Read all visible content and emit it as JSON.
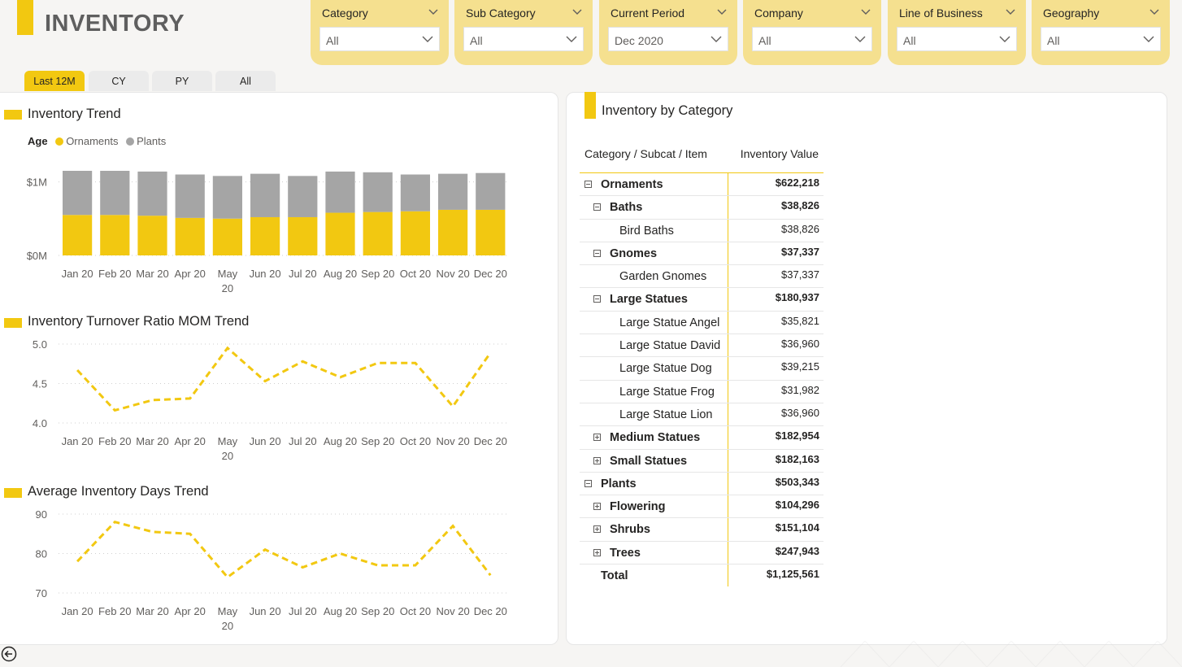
{
  "page": {
    "title": "INVENTORY"
  },
  "slicers": [
    {
      "label": "Category",
      "value": "All"
    },
    {
      "label": "Sub Category",
      "value": "All"
    },
    {
      "label": "Current Period",
      "value": "Dec 2020"
    },
    {
      "label": "Company",
      "value": "All"
    },
    {
      "label": "Line of Business",
      "value": "All"
    },
    {
      "label": "Geography",
      "value": "All"
    }
  ],
  "tabs": [
    {
      "label": "Last 12M",
      "active": true
    },
    {
      "label": "CY",
      "active": false
    },
    {
      "label": "PY",
      "active": false
    },
    {
      "label": "All",
      "active": false
    }
  ],
  "colors": {
    "accent": "#f2c811",
    "grey": "#a5a5a5",
    "slicer_bg": "#f5e08f"
  },
  "chart_data": [
    {
      "type": "bar",
      "title": "Inventory Trend",
      "legend_title": "Age",
      "categories": [
        "Jan 20",
        "Feb 20",
        "Mar 20",
        "Apr 20",
        "May 20",
        "Jun 20",
        "Jul 20",
        "Aug 20",
        "Sep 20",
        "Oct 20",
        "Nov 20",
        "Dec 20"
      ],
      "series": [
        {
          "name": "Ornaments",
          "color": "#f2c811",
          "values": [
            0.55,
            0.55,
            0.54,
            0.51,
            0.5,
            0.52,
            0.52,
            0.58,
            0.59,
            0.6,
            0.62,
            0.62
          ]
        },
        {
          "name": "Plants",
          "color": "#a5a5a5",
          "values": [
            0.6,
            0.6,
            0.6,
            0.59,
            0.58,
            0.59,
            0.56,
            0.56,
            0.54,
            0.5,
            0.49,
            0.5
          ]
        }
      ],
      "yticks": [
        "$1M",
        "$0M"
      ],
      "ylim": [
        0,
        1.15
      ],
      "stacked": true,
      "grid": true
    },
    {
      "type": "line",
      "title": "Inventory Turnover Ratio MOM Trend",
      "categories": [
        "Jan 20",
        "Feb 20",
        "Mar 20",
        "Apr 20",
        "May 20",
        "Jun 20",
        "Jul 20",
        "Aug 20",
        "Sep 20",
        "Oct 20",
        "Nov 20",
        "Dec 20"
      ],
      "series": [
        {
          "color": "#f2c811",
          "values": [
            4.67,
            4.16,
            4.29,
            4.31,
            4.95,
            4.53,
            4.78,
            4.58,
            4.76,
            4.76,
            4.21,
            4.89
          ]
        }
      ],
      "yticks": [
        "5.0",
        "4.5",
        "4.0"
      ],
      "ylim": [
        4.0,
        5.0
      ],
      "grid": true
    },
    {
      "type": "line",
      "title": "Average Inventory Days Trend",
      "categories": [
        "Jan 20",
        "Feb 20",
        "Mar 20",
        "Apr 20",
        "May 20",
        "Jun 20",
        "Jul 20",
        "Aug 20",
        "Sep 20",
        "Oct 20",
        "Nov 20",
        "Dec 20"
      ],
      "series": [
        {
          "color": "#f2c811",
          "values": [
            78,
            88,
            85.5,
            85,
            74,
            81,
            76.5,
            80,
            77,
            77,
            87,
            74.5
          ]
        }
      ],
      "yticks": [
        "90",
        "80",
        "70"
      ],
      "ylim": [
        70,
        90
      ],
      "grid": true
    }
  ],
  "matrix": {
    "title": "Inventory by Category",
    "col1": "Category / Subcat / Item",
    "col2": "Inventory Value",
    "rows": [
      {
        "label": "Ornaments",
        "value": "$622,218",
        "level": 0,
        "bold": true,
        "toggle": "minus"
      },
      {
        "label": "Baths",
        "value": "$38,826",
        "level": 1,
        "bold": true,
        "toggle": "minus"
      },
      {
        "label": "Bird Baths",
        "value": "$38,826",
        "level": 2,
        "bold": false,
        "toggle": ""
      },
      {
        "label": "Gnomes",
        "value": "$37,337",
        "level": 1,
        "bold": true,
        "toggle": "minus"
      },
      {
        "label": "Garden Gnomes",
        "value": "$37,337",
        "level": 2,
        "bold": false,
        "toggle": ""
      },
      {
        "label": "Large Statues",
        "value": "$180,937",
        "level": 1,
        "bold": true,
        "toggle": "minus"
      },
      {
        "label": "Large Statue Angel",
        "value": "$35,821",
        "level": 2,
        "bold": false,
        "toggle": ""
      },
      {
        "label": "Large Statue David",
        "value": "$36,960",
        "level": 2,
        "bold": false,
        "toggle": ""
      },
      {
        "label": "Large Statue Dog",
        "value": "$39,215",
        "level": 2,
        "bold": false,
        "toggle": ""
      },
      {
        "label": "Large Statue Frog",
        "value": "$31,982",
        "level": 2,
        "bold": false,
        "toggle": ""
      },
      {
        "label": "Large Statue Lion",
        "value": "$36,960",
        "level": 2,
        "bold": false,
        "toggle": ""
      },
      {
        "label": "Medium Statues",
        "value": "$182,954",
        "level": 1,
        "bold": true,
        "toggle": "plus"
      },
      {
        "label": "Small Statues",
        "value": "$182,163",
        "level": 1,
        "bold": true,
        "toggle": "plus"
      },
      {
        "label": "Plants",
        "value": "$503,343",
        "level": 0,
        "bold": true,
        "toggle": "minus"
      },
      {
        "label": "Flowering",
        "value": "$104,296",
        "level": 1,
        "bold": true,
        "toggle": "plus"
      },
      {
        "label": "Shrubs",
        "value": "$151,104",
        "level": 1,
        "bold": true,
        "toggle": "plus"
      },
      {
        "label": "Trees",
        "value": "$247,943",
        "level": 1,
        "bold": true,
        "toggle": "plus"
      },
      {
        "label": "Total",
        "value": "$1,125,561",
        "level": 0,
        "bold": true,
        "toggle": "",
        "total": true
      }
    ]
  }
}
